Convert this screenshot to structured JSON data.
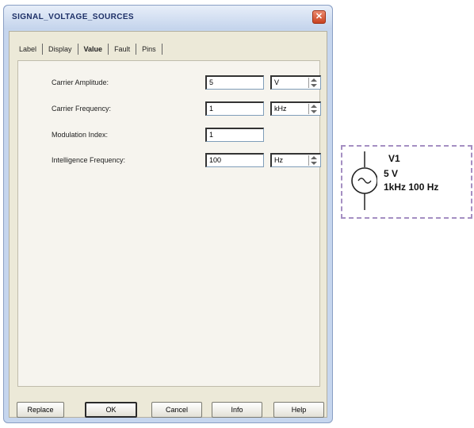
{
  "window": {
    "title": "SIGNAL_VOLTAGE_SOURCES",
    "close_glyph": "✕"
  },
  "tabs": [
    {
      "label": "Label"
    },
    {
      "label": "Display"
    },
    {
      "label": "Value"
    },
    {
      "label": "Fault"
    },
    {
      "label": "Pins"
    }
  ],
  "active_tab": "Value",
  "fields": {
    "carrier_amplitude": {
      "label": "Carrier Amplitude:",
      "value": "5",
      "unit": "V"
    },
    "carrier_frequency": {
      "label": "Carrier Frequency:",
      "value": "1",
      "unit": "kHz"
    },
    "modulation_index": {
      "label": "Modulation Index:",
      "value": "1"
    },
    "intelligence_frequency": {
      "label": "Intelligence Frequency:",
      "value": "100",
      "unit": "Hz"
    }
  },
  "buttons": {
    "replace": "Replace",
    "ok": "OK",
    "cancel": "Cancel",
    "info": "Info",
    "help": "Help"
  },
  "symbol": {
    "ref": "V1",
    "amplitude": "5 V",
    "frequencies": "1kHz 100 Hz"
  },
  "colors": {
    "title_bar": "#c4d4ec",
    "close_button": "#c9421f",
    "dialog_face": "#ece9d8",
    "symbol_border": "#a58fc2"
  }
}
